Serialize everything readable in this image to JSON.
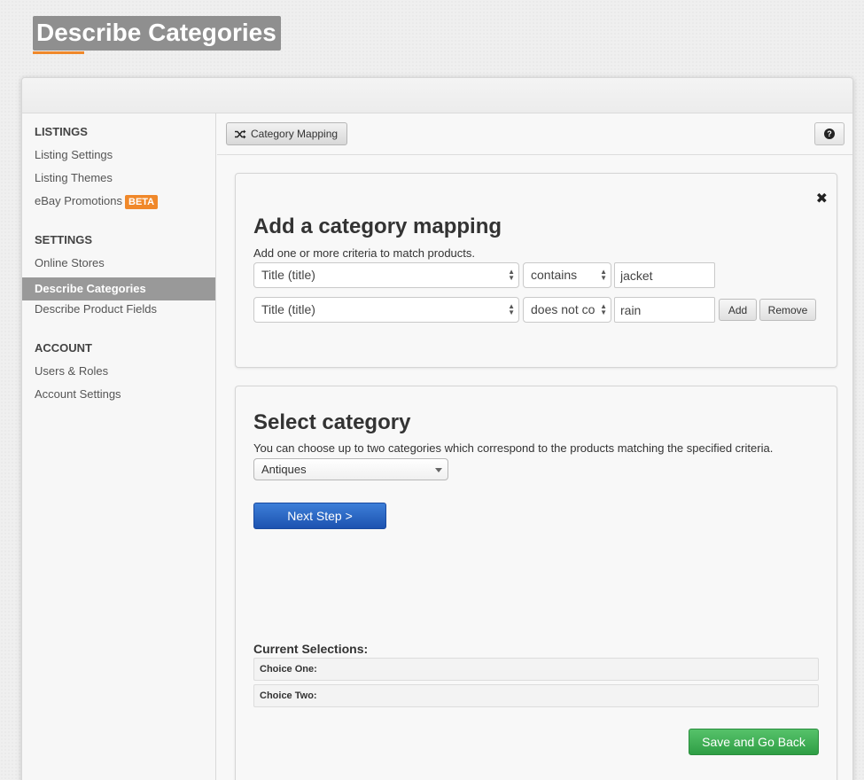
{
  "page": {
    "title": "Describe Categories"
  },
  "sidebar": {
    "sections": [
      {
        "heading": "LISTINGS",
        "items": [
          {
            "label": "Listing Settings"
          },
          {
            "label": "Listing Themes"
          },
          {
            "label": "eBay Promotions",
            "badge": "BETA"
          }
        ]
      },
      {
        "heading": "SETTINGS",
        "items": [
          {
            "label": "Online Stores"
          },
          {
            "label": "Describe Categories",
            "active": true
          },
          {
            "label": "Describe Product Fields"
          }
        ]
      },
      {
        "heading": "ACCOUNT",
        "items": [
          {
            "label": "Users & Roles"
          },
          {
            "label": "Account Settings"
          }
        ]
      }
    ]
  },
  "toolbar": {
    "category_mapping_label": "Category Mapping",
    "help_icon": "?"
  },
  "mapping": {
    "close_icon": "✖",
    "title": "Add a category mapping",
    "subtitle": "Add one or more criteria to match products.",
    "criteria": [
      {
        "field": "Title (title)",
        "operator": "contains",
        "value": "jacket"
      },
      {
        "field": "Title (title)",
        "operator": "does not co",
        "value": "rain"
      }
    ],
    "add_label": "Add",
    "remove_label": "Remove"
  },
  "category": {
    "title": "Select category",
    "subtitle": "You can choose up to two categories which correspond to the products matching the specified criteria.",
    "selected": "Antiques",
    "next_label": "Next Step >",
    "current_label": "Current Selections:",
    "choice_one": "Choice One:",
    "choice_two": "Choice Two:",
    "save_label": "Save and Go Back"
  },
  "colors": {
    "accent": "#f0882a",
    "primary_button": "#1c52b0",
    "success_button": "#2f9e45",
    "active_nav": "#999999"
  }
}
